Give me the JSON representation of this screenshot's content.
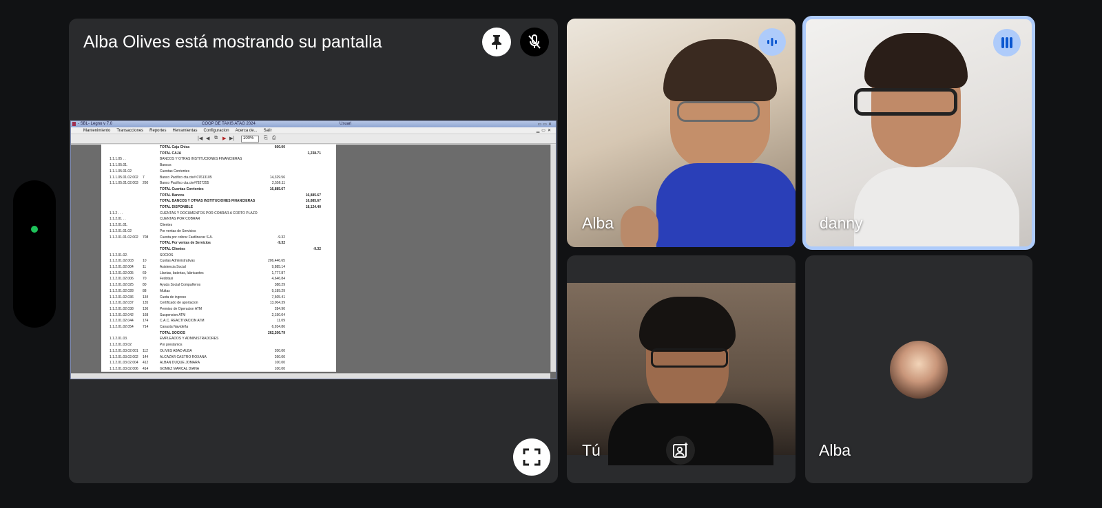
{
  "presenter": {
    "title": "Alba Olives está mostrando su pantalla",
    "pin_icon": "pin-icon",
    "mute_icon": "mic-off-icon",
    "fullscreen_icon": "fullscreen-icon"
  },
  "shared_screen": {
    "window_title_app": "- SBL- Legno v 7.0",
    "window_title_company": "COOP DE TAXIS ATAG 2024",
    "window_title_user": "Usuari",
    "menu": [
      "Mantenimiento",
      "Transacciones",
      "Reportes",
      "Herramientas",
      "Configuracion",
      "Acerca de...",
      "Salir"
    ],
    "zoom": "100%",
    "rows": [
      {
        "code": "",
        "num": "",
        "desc": "TOTAL Caja Chica",
        "amt": "600.00",
        "tot": "",
        "bold": true
      },
      {
        "code": "",
        "num": "",
        "desc": "TOTAL CAJA",
        "amt": "",
        "tot": "1,238.71",
        "bold": true
      },
      {
        "code": "1.1.1.05 . .",
        "num": "",
        "desc": "BANCOS Y OTRAS INSTITUCIONES FINANCIERAS",
        "amt": "",
        "tot": "",
        "bold": false
      },
      {
        "code": "1.1.1.05.01.",
        "num": "",
        "desc": "Bancos",
        "amt": "",
        "tot": "",
        "bold": false
      },
      {
        "code": "1.1.1.05.01.02",
        "num": "",
        "desc": "Cuentas Corrientes",
        "amt": "",
        "tot": "",
        "bold": false
      },
      {
        "code": "1.1.1.05.01.02.002",
        "num": "7",
        "desc": "Banco Pacifico cta.cte# 07613105",
        "amt": "14,329.56",
        "tot": "",
        "bold": false
      },
      {
        "code": "1.1.1.05.01.02.003",
        "num": "260",
        "desc": "Banco Pacifico cta.cte#7827255",
        "amt": "2,556.11",
        "tot": "",
        "bold": false
      },
      {
        "code": "",
        "num": "",
        "desc": "TOTAL Cuentas Corrientes",
        "amt": "16,885.67",
        "tot": "",
        "bold": true
      },
      {
        "code": "",
        "num": "",
        "desc": "TOTAL Bancos",
        "amt": "",
        "tot": "16,885.67",
        "bold": true
      },
      {
        "code": "",
        "num": "",
        "desc": "TOTAL BANCOS Y OTRAS INSTITUCIONES FINANCIERAS",
        "amt": "",
        "tot": "16,885.67",
        "bold": true
      },
      {
        "code": "",
        "num": "",
        "desc": "TOTAL DISPONIBLE",
        "amt": "",
        "tot": "18,124.40",
        "bold": true
      },
      {
        "code": "1.1.2 . . .",
        "num": "",
        "desc": "CUENTAS Y DOCUMENTOS POR COBRAR A CORTO PLAZO",
        "amt": "",
        "tot": "",
        "bold": false
      },
      {
        "code": "1.1.2.01 . .",
        "num": "",
        "desc": "CUENTAS POR COBRAR",
        "amt": "",
        "tot": "",
        "bold": false
      },
      {
        "code": "1.1.2.01.01.",
        "num": "",
        "desc": "Clientes",
        "amt": "",
        "tot": "",
        "bold": false
      },
      {
        "code": "1.1.2.01.01.02",
        "num": "",
        "desc": "Por ventas de Servicios",
        "amt": "",
        "tot": "",
        "bold": false
      },
      {
        "code": "1.1.2.01.01.02.002",
        "num": "708",
        "desc": "Cuenta por cobrar Fastlinecar S.A.",
        "amt": "-9.32",
        "tot": "",
        "bold": false
      },
      {
        "code": "",
        "num": "",
        "desc": "TOTAL Por ventas de Servicios",
        "amt": "-9.32",
        "tot": "",
        "bold": true
      },
      {
        "code": "",
        "num": "",
        "desc": "TOTAL Clientes",
        "amt": "",
        "tot": "-9.32",
        "bold": true
      },
      {
        "code": "1.1.2.01.02.",
        "num": "",
        "desc": "SOCIOS",
        "amt": "",
        "tot": "",
        "bold": false
      },
      {
        "code": "1.1.2.01.02.003",
        "num": "10",
        "desc": "Cuotas Administrativas",
        "amt": "206,446.65",
        "tot": "",
        "bold": false
      },
      {
        "code": "1.1.2.01.02.004",
        "num": "11",
        "desc": "Asistencia Social",
        "amt": "9,885.14",
        "tot": "",
        "bold": false
      },
      {
        "code": "1.1.2.01.02.005",
        "num": "69",
        "desc": "Llantas, baterias, lubricantes",
        "amt": "1,777.87",
        "tot": "",
        "bold": false
      },
      {
        "code": "1.1.2.01.02.006",
        "num": "70",
        "desc": "Fedotaxi",
        "amt": "4,646.84",
        "tot": "",
        "bold": false
      },
      {
        "code": "1.1.2.01.02.025",
        "num": "80",
        "desc": "Ayuda Social Compañeros",
        "amt": "388.29",
        "tot": "",
        "bold": false
      },
      {
        "code": "1.1.2.01.02.028",
        "num": "88",
        "desc": "Multas",
        "amt": "9,189.29",
        "tot": "",
        "bold": false
      },
      {
        "code": "1.1.2.01.02.036",
        "num": "134",
        "desc": "Cuota de ingreso",
        "amt": "7,505.41",
        "tot": "",
        "bold": false
      },
      {
        "code": "1.1.2.01.02.037",
        "num": "135",
        "desc": "Certificado de aportacion",
        "amt": "13,004.39",
        "tot": "",
        "bold": false
      },
      {
        "code": "1.1.2.01.02.038",
        "num": "136",
        "desc": "Permiso de Operacion ATM",
        "amt": "284.90",
        "tot": "",
        "bold": false
      },
      {
        "code": "1.1.2.01.02.042",
        "num": "168",
        "desc": "Suspension ATM",
        "amt": "2,150.04",
        "tot": "",
        "bold": false
      },
      {
        "code": "1.1.2.01.02.044",
        "num": "174",
        "desc": "C.A.C. REACTIVACION ATM",
        "amt": "11.09",
        "tot": "",
        "bold": false
      },
      {
        "code": "1.1.2.01.02.054",
        "num": "714",
        "desc": "Canasta Navideña",
        "amt": "6,934.86",
        "tot": "",
        "bold": false
      },
      {
        "code": "",
        "num": "",
        "desc": "TOTAL SOCIOS",
        "amt": "262,206.79",
        "tot": "",
        "bold": true
      },
      {
        "code": "1.1.2.01.03.",
        "num": "",
        "desc": "EMPLEADOS Y ADMINISTRADORES",
        "amt": "",
        "tot": "",
        "bold": false
      },
      {
        "code": "1.1.2.01.03.02",
        "num": "",
        "desc": "Por prestamos",
        "amt": "",
        "tot": "",
        "bold": false
      },
      {
        "code": "1.1.2.01.03.02.001",
        "num": "112",
        "desc": "OLIVES ABAD ALBA",
        "amt": "200.00",
        "tot": "",
        "bold": false
      },
      {
        "code": "1.1.2.01.03.02.002",
        "num": "144",
        "desc": "ALCAZAR CASTRO ROXANA",
        "amt": "260.00",
        "tot": "",
        "bold": false
      },
      {
        "code": "1.1.2.01.03.02.004",
        "num": "412",
        "desc": "ALBAN DUQUE JOMARA",
        "amt": "100.00",
        "tot": "",
        "bold": false
      },
      {
        "code": "1.1.2.01.03.02.006",
        "num": "414",
        "desc": "GOMEZ MARCAL DIANA",
        "amt": "100.00",
        "tot": "",
        "bold": false
      }
    ]
  },
  "participants": {
    "alba_cam": {
      "name": "Alba",
      "speaking_icon": "audio-level-icon"
    },
    "danny_cam": {
      "name": "danny",
      "speaking_icon": "audio-level-icon"
    },
    "self": {
      "name": "Tú",
      "effects_icon": "visual-effects-icon"
    },
    "alba_avatar": {
      "name": "Alba"
    }
  },
  "colors": {
    "background": "#111214",
    "tile": "#2a2b2d",
    "active_speaker_border": "#aecbfa",
    "status_dot": "#1ec25a"
  }
}
